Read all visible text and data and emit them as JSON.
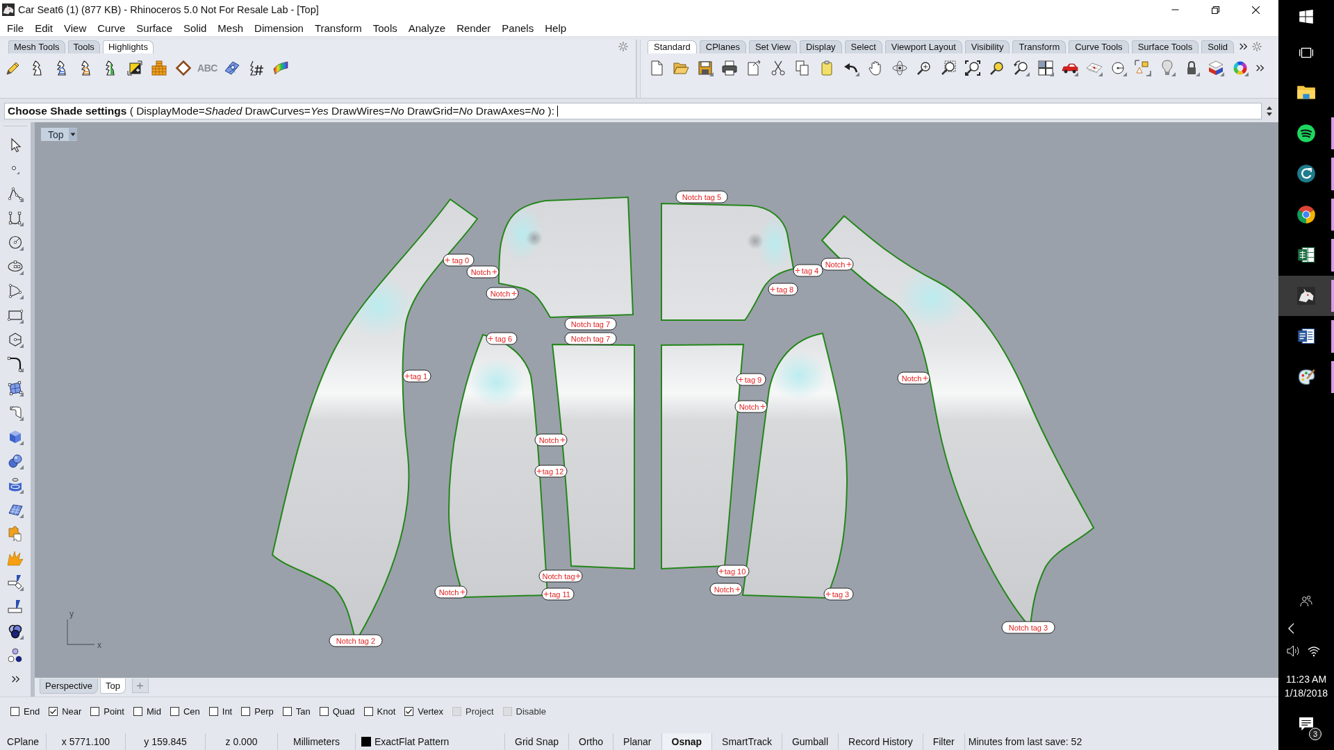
{
  "window": {
    "title": "Car Seat6 (1) (877 KB) - Rhinoceros 5.0 Not For Resale Lab - [Top]"
  },
  "menu": [
    "File",
    "Edit",
    "View",
    "Curve",
    "Surface",
    "Solid",
    "Mesh",
    "Dimension",
    "Transform",
    "Tools",
    "Analyze",
    "Render",
    "Panels",
    "Help"
  ],
  "toolbar_left": {
    "tabs": [
      {
        "label": "Mesh Tools",
        "selected": false
      },
      {
        "label": "Tools",
        "selected": false
      },
      {
        "label": "Highlights",
        "selected": true
      }
    ],
    "text_button": "ABC"
  },
  "toolbar_right": {
    "tabs": [
      {
        "label": "Standard",
        "selected": true
      },
      {
        "label": "CPlanes",
        "selected": false
      },
      {
        "label": "Set View",
        "selected": false
      },
      {
        "label": "Display",
        "selected": false
      },
      {
        "label": "Select",
        "selected": false
      },
      {
        "label": "Viewport Layout",
        "selected": false
      },
      {
        "label": "Visibility",
        "selected": false
      },
      {
        "label": "Transform",
        "selected": false
      },
      {
        "label": "Curve Tools",
        "selected": false
      },
      {
        "label": "Surface Tools",
        "selected": false
      },
      {
        "label": "Solid",
        "selected": false
      }
    ]
  },
  "command_line": {
    "prompt": "**Choose Shade settings** ( DisplayMode=*Shaded* DrawCurves=*Yes* DrawWires=*No* DrawGrid=*No* DrawAxes=*No* ):"
  },
  "viewport": {
    "title": "Top",
    "labels": [
      {
        "text": "Notch tag 5"
      },
      {
        "text": "tag 0"
      },
      {
        "text": "Notch"
      },
      {
        "text": "tag 4"
      },
      {
        "text": "Notch"
      },
      {
        "text": "Notch"
      },
      {
        "text": "tag 8"
      },
      {
        "text": "Notch tag 7"
      },
      {
        "text": "tag 6"
      },
      {
        "text": "Notch tag 7"
      },
      {
        "text": "tag 1"
      },
      {
        "text": "tag 9"
      },
      {
        "text": "Notch"
      },
      {
        "text": "Notch"
      },
      {
        "text": "Notch"
      },
      {
        "text": "tag 12"
      },
      {
        "text": "Notch tag"
      },
      {
        "text": "tag 10"
      },
      {
        "text": "Notch"
      },
      {
        "text": "tag 11"
      },
      {
        "text": "Notch"
      },
      {
        "text": "tag 3"
      },
      {
        "text": "Notch tag 3"
      },
      {
        "text": "Notch tag 2"
      }
    ],
    "axes": {
      "y": "y",
      "x": "x"
    }
  },
  "viewport_tabs": [
    {
      "label": "Perspective",
      "selected": false
    },
    {
      "label": "Top",
      "selected": true
    }
  ],
  "osnaps": [
    {
      "label": "End",
      "checked": false,
      "disabled": false
    },
    {
      "label": "Near",
      "checked": true,
      "disabled": false
    },
    {
      "label": "Point",
      "checked": false,
      "disabled": false
    },
    {
      "label": "Mid",
      "checked": false,
      "disabled": false
    },
    {
      "label": "Cen",
      "checked": false,
      "disabled": false
    },
    {
      "label": "Int",
      "checked": false,
      "disabled": false
    },
    {
      "label": "Perp",
      "checked": false,
      "disabled": false
    },
    {
      "label": "Tan",
      "checked": false,
      "disabled": false
    },
    {
      "label": "Quad",
      "checked": false,
      "disabled": false
    },
    {
      "label": "Knot",
      "checked": false,
      "disabled": false
    },
    {
      "label": "Vertex",
      "checked": true,
      "disabled": false
    },
    {
      "label": "Project",
      "checked": false,
      "disabled": true
    },
    {
      "label": "Disable",
      "checked": false,
      "disabled": true
    }
  ],
  "status_bar": {
    "cplane": "CPlane",
    "x": "x 5771.100",
    "y": "y 159.845",
    "z": "z 0.000",
    "units": "Millimeters",
    "layer": {
      "name": "ExactFlat Pattern",
      "color": "#000000"
    },
    "toggles": [
      {
        "label": "Grid Snap",
        "on": false
      },
      {
        "label": "Ortho",
        "on": false
      },
      {
        "label": "Planar",
        "on": false
      },
      {
        "label": "Osnap",
        "on": true
      },
      {
        "label": "SmartTrack",
        "on": false
      },
      {
        "label": "Gumball",
        "on": false
      },
      {
        "label": "Record History",
        "on": false
      },
      {
        "label": "Filter",
        "on": false
      }
    ],
    "info": "Minutes from last save: 52"
  },
  "taskbar": {
    "apps": [
      {
        "kind": "folder",
        "running": false,
        "selected": false
      },
      {
        "kind": "music",
        "running": true,
        "selected": false
      },
      {
        "kind": "sync",
        "running": true,
        "selected": false
      },
      {
        "kind": "browser",
        "running": true,
        "selected": false
      },
      {
        "kind": "sheet",
        "running": true,
        "selected": false
      },
      {
        "kind": "rhino",
        "running": true,
        "selected": true
      },
      {
        "kind": "document",
        "running": true,
        "selected": false
      },
      {
        "kind": "paint",
        "running": true,
        "selected": false
      }
    ],
    "time": "11:23 AM",
    "date": "1/18/2018",
    "notification_count": "3"
  }
}
